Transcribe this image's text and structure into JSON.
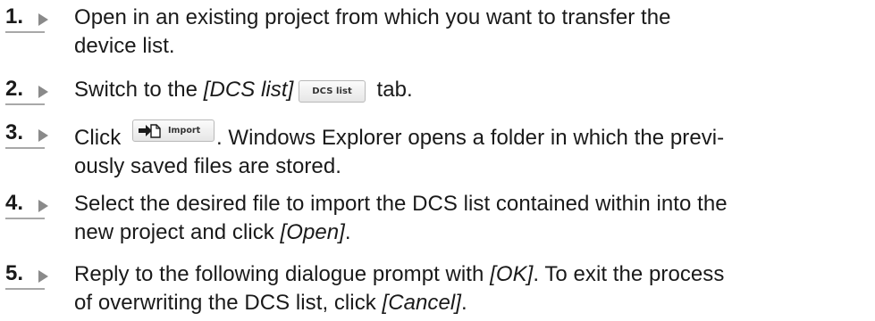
{
  "steps": [
    {
      "number": "1.",
      "line1": "Open in an existing project from which you want to transfer the",
      "line2": "device list."
    },
    {
      "number": "2.",
      "before": "Switch to the ",
      "em": "[DCS list]",
      "button_label": "DCS list",
      "after": " tab."
    },
    {
      "number": "3.",
      "before": "Click ",
      "button_label": "Import",
      "after": ". Windows Explorer opens a folder in which the previ-",
      "line2": "ously saved files are stored."
    },
    {
      "number": "4.",
      "line1": "Select the desired file to import the DCS list contained within into the",
      "line2_before": "new project and click ",
      "line2_em": "[Open]",
      "line2_after": "."
    },
    {
      "number": "5.",
      "line1_before": "Reply to the following dialogue prompt with ",
      "line1_em": "[OK]",
      "line1_after": ". To exit the process",
      "line2_before": "of overwriting the DCS list, click ",
      "line2_em": "[Cancel]",
      "line2_after": "."
    }
  ]
}
